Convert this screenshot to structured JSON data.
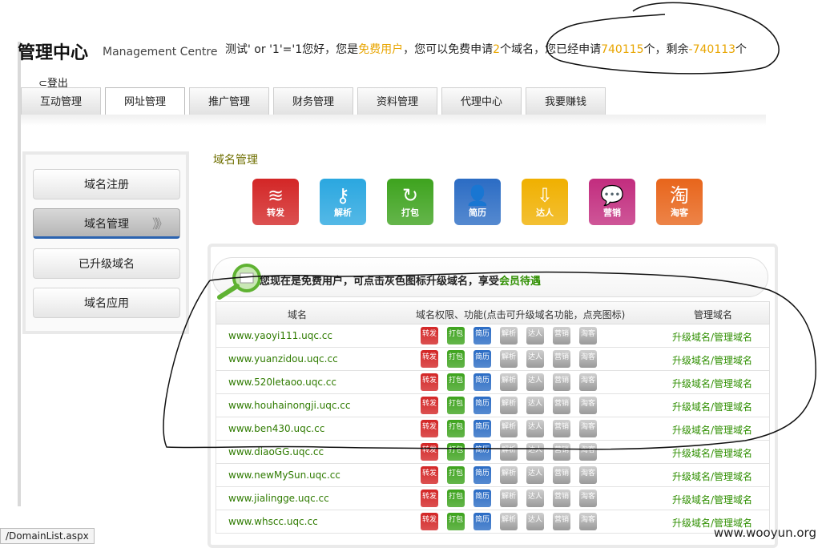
{
  "header": {
    "title": "管理中心",
    "subtitle": "Management Centre",
    "greet_prefix": "测试' or '1'='1您好，您是",
    "user_type": "免费用户",
    "greet_mid1": "，您可以免费申请",
    "free_count": "2",
    "greet_mid2": "个域名，您已经申请",
    "applied_count": "740115",
    "greet_mid3": "个，剩余",
    "remaining": "-740113",
    "greet_suffix": "个",
    "logout": "⊂登出"
  },
  "tabs": [
    "互动管理",
    "网址管理",
    "推广管理",
    "财务管理",
    "资料管理",
    "代理中心",
    "我要赚钱"
  ],
  "sidebar": {
    "items": [
      "域名注册",
      "域名管理",
      "已升级域名",
      "域名应用"
    ],
    "active_arrows": "》》"
  },
  "section_title": "域名管理",
  "big_icons": [
    {
      "label": "转发",
      "glyph": "≋",
      "color": "#d32626"
    },
    {
      "label": "解析",
      "glyph": "⚷",
      "color": "#2aa7e0"
    },
    {
      "label": "打包",
      "glyph": "↻",
      "color": "#3ea31e"
    },
    {
      "label": "简历",
      "glyph": "👤",
      "color": "#2b6cc4"
    },
    {
      "label": "达人",
      "glyph": "⇩",
      "color": "#f0b000"
    },
    {
      "label": "营销",
      "glyph": "💬",
      "color": "#c22c7e"
    },
    {
      "label": "淘客",
      "glyph": "淘",
      "color": "#e8651b"
    }
  ],
  "notice": {
    "text": "您现在是免费用户，可点击灰色图标升级域名，享受",
    "link": "会员待遇"
  },
  "table": {
    "headers": [
      "域名",
      "域名权限、功能(点击可升级域名功能，点亮图标)",
      "管理域名"
    ],
    "rows": [
      "www.yaoyi111.uqc.cc",
      "www.yuanzidou.uqc.cc",
      "www.520letaoo.uqc.cc",
      "www.houhainongji.uqc.cc",
      "www.ben430.uqc.cc",
      "www.diaoGG.uqc.cc",
      "www.newMySun.uqc.cc",
      "www.jialingge.uqc.cc",
      "www.whscc.uqc.cc"
    ],
    "manage_text": "升级域名/管理域名",
    "small_icons": [
      {
        "label": "转发",
        "color": "#d32626",
        "grey": false
      },
      {
        "label": "打包",
        "color": "#3ea31e",
        "grey": false
      },
      {
        "label": "简历",
        "color": "#2b6cc4",
        "grey": false
      },
      {
        "label": "解析",
        "color": "#999",
        "grey": true
      },
      {
        "label": "达人",
        "color": "#999",
        "grey": true
      },
      {
        "label": "营销",
        "color": "#999",
        "grey": true
      },
      {
        "label": "淘客",
        "color": "#999",
        "grey": true
      }
    ]
  },
  "status_bar": "/DomainList.aspx",
  "watermark": "www.wooyun.org"
}
